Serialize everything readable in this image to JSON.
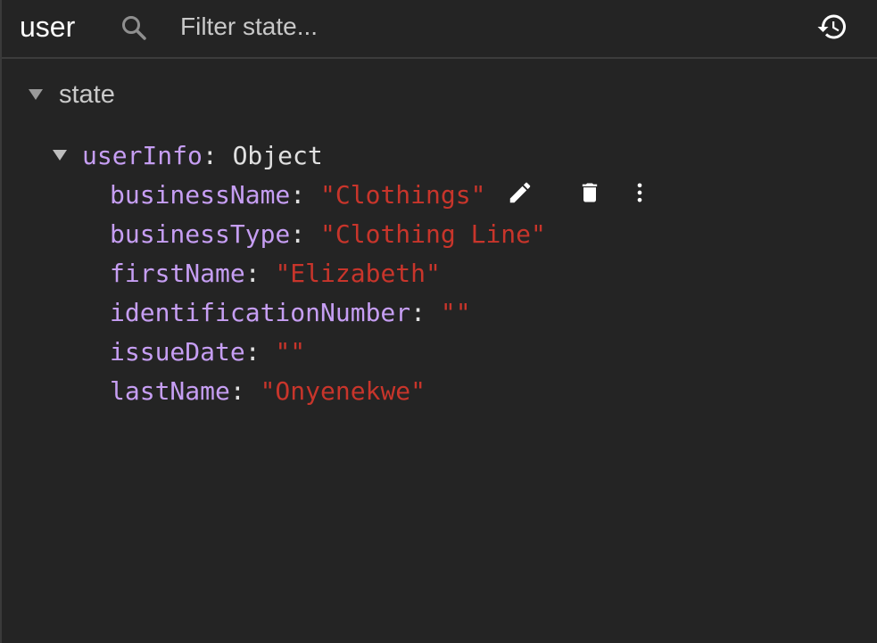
{
  "toolbar": {
    "component_name": "user",
    "filter_placeholder": "Filter state...",
    "filter_value": "",
    "search_icon": "search-icon",
    "history_icon": "history-icon"
  },
  "tree": {
    "root_label": "state",
    "object": {
      "key": "userInfo",
      "type": "Object",
      "properties": [
        {
          "key": "businessName",
          "value": "\"Clothings\""
        },
        {
          "key": "businessType",
          "value": "\"Clothing Line\""
        },
        {
          "key": "firstName",
          "value": "\"Elizabeth\""
        },
        {
          "key": "identificationNumber",
          "value": "\"\""
        },
        {
          "key": "issueDate",
          "value": "\"\""
        },
        {
          "key": "lastName",
          "value": "\"Onyenekwe\""
        }
      ]
    }
  },
  "row_actions": {
    "edit_icon": "pencil-icon",
    "delete_icon": "trash-icon",
    "more_icon": "more-vertical-icon"
  },
  "colors": {
    "background": "#242424",
    "key": "#c69ef3",
    "string": "#c8352b",
    "text": "#e0e0e0"
  }
}
